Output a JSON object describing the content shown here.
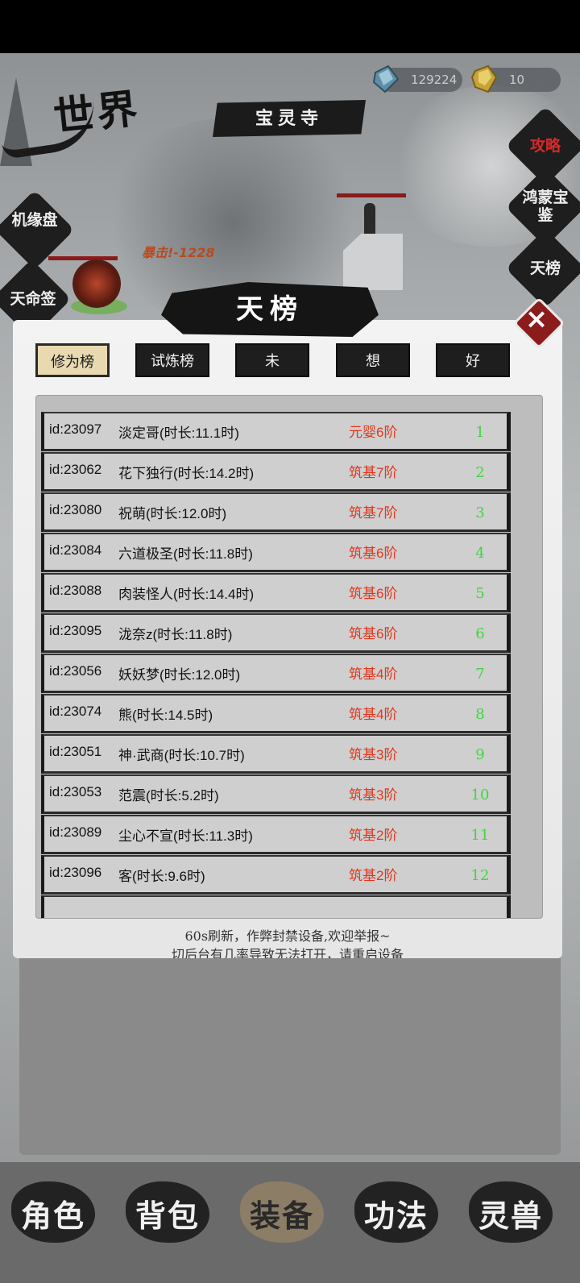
{
  "header": {
    "world_title": "世界",
    "location": "宝灵寺",
    "jade_count": "129224",
    "gold_count": "10"
  },
  "left_menu": {
    "item1": "机缘盘",
    "item2": "天命签"
  },
  "right_menu": {
    "guide": "攻略",
    "treasure": "鸿蒙宝鉴",
    "ranking": "天榜"
  },
  "battle": {
    "damage_text": "暴击!-1228"
  },
  "panel": {
    "title": "天榜",
    "close_label": "×",
    "tabs": [
      "修为榜",
      "试炼榜",
      "未",
      "想",
      "好"
    ],
    "rows": [
      {
        "id": "id:23097",
        "name": "淡定哥(时长:11.1时)",
        "realm": "元婴6阶",
        "rank": "1"
      },
      {
        "id": "id:23062",
        "name": "花下独行(时长:14.2时)",
        "realm": "筑基7阶",
        "rank": "2"
      },
      {
        "id": "id:23080",
        "name": "祝萌(时长:12.0时)",
        "realm": "筑基7阶",
        "rank": "3"
      },
      {
        "id": "id:23084",
        "name": "六道极圣(时长:11.8时)",
        "realm": "筑基6阶",
        "rank": "4"
      },
      {
        "id": "id:23088",
        "name": "肉装怪人(时长:14.4时)",
        "realm": "筑基6阶",
        "rank": "5"
      },
      {
        "id": "id:23095",
        "name": "泷奈z(时长:11.8时)",
        "realm": "筑基6阶",
        "rank": "6"
      },
      {
        "id": "id:23056",
        "name": "妖妖梦(时长:12.0时)",
        "realm": "筑基4阶",
        "rank": "7"
      },
      {
        "id": "id:23074",
        "name": "熊(时长:14.5时)",
        "realm": "筑基4阶",
        "rank": "8"
      },
      {
        "id": "id:23051",
        "name": "神·武商(时长:10.7时)",
        "realm": "筑基3阶",
        "rank": "9"
      },
      {
        "id": "id:23053",
        "name": "范震(时长:5.2时)",
        "realm": "筑基3阶",
        "rank": "10"
      },
      {
        "id": "id:23089",
        "name": "尘心不宣(时长:11.3时)",
        "realm": "筑基2阶",
        "rank": "11"
      },
      {
        "id": "id:23096",
        "name": "客(时长:9.6时)",
        "realm": "筑基2阶",
        "rank": "12"
      }
    ],
    "notice_line1": "60s刷新，作弊封禁设备,欢迎举报~",
    "notice_line2": "切后台有几率导致无法打开，请重启设备"
  },
  "bottom_nav": [
    "角色",
    "背包",
    "装备",
    "功法",
    "灵兽"
  ],
  "colors": {
    "realm_text": "#e2371c",
    "rank_text": "#3fd63f",
    "active_tab": "#e9d9b0"
  }
}
